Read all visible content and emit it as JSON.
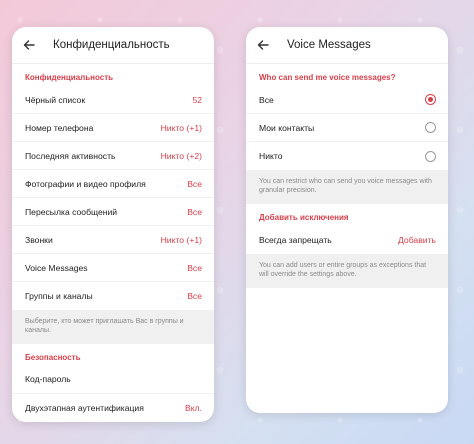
{
  "left_screen": {
    "title": "Конфиденциальность",
    "section_privacy": "Конфиденциальность",
    "items": [
      {
        "label": "Чёрный список",
        "value": "52"
      },
      {
        "label": "Номер телефона",
        "value": "Никто (+1)"
      },
      {
        "label": "Последняя активность",
        "value": "Никто (+2)"
      },
      {
        "label": "Фотографии и видео профиля",
        "value": "Все"
      },
      {
        "label": "Пересылка сообщений",
        "value": "Все"
      },
      {
        "label": "Звонки",
        "value": "Никто (+1)"
      },
      {
        "label": "Voice Messages",
        "value": "Все"
      },
      {
        "label": "Группы и каналы",
        "value": "Все"
      }
    ],
    "groups_hint": "Выберите, кто может приглашать Вас в группы и каналы.",
    "section_security": "Безопасность",
    "security_items": [
      {
        "label": "Код-пароль",
        "value": ""
      },
      {
        "label": "Двухэтапная аутентификация",
        "value": "Вкл."
      }
    ]
  },
  "right_screen": {
    "title": "Voice Messages",
    "section_who": "Who can send me voice messages?",
    "options": [
      {
        "label": "Все",
        "selected": true
      },
      {
        "label": "Мои контакты",
        "selected": false
      },
      {
        "label": "Никто",
        "selected": false
      }
    ],
    "who_hint": "You can restrict who can send you voice messages with granular precision.",
    "section_exceptions": "Добавить исключения",
    "exception_row": {
      "label": "Всегда запрещать",
      "value": "Добавить"
    },
    "exceptions_hint": "You can add users or entire groups as exceptions that will override the settings above."
  },
  "colors": {
    "accent": "#d6404b",
    "hint_bg": "#f0f0f0"
  },
  "icons": {
    "back": "back-arrow-icon",
    "radio_checked": "radio-checked-icon",
    "radio_unchecked": "radio-unchecked-icon"
  }
}
